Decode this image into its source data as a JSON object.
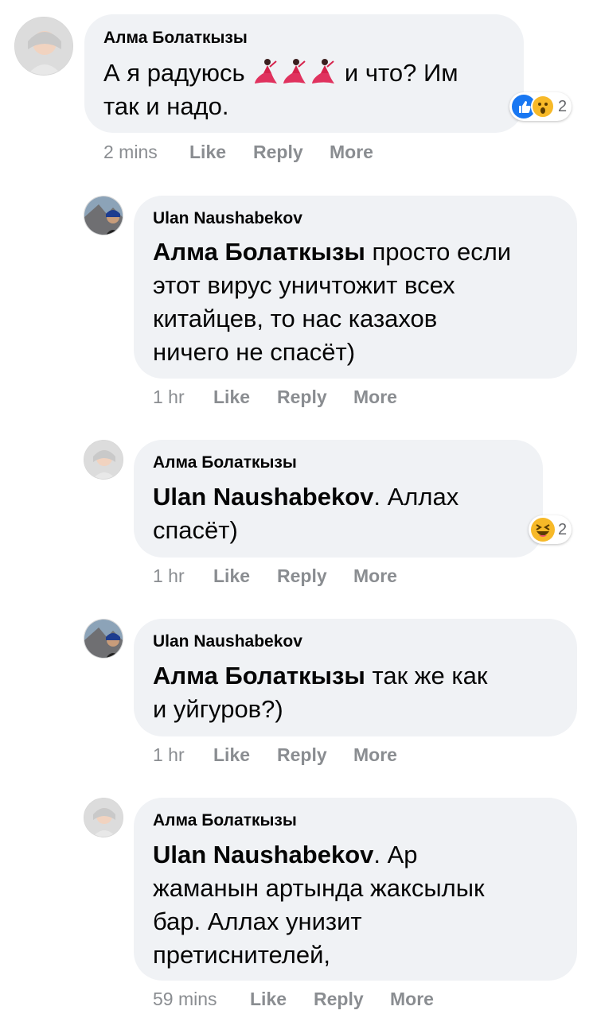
{
  "comments": [
    {
      "author": "Алма Болаткызы",
      "lines": [
        "А я радуюсь",
        "и что? Им",
        "так и надо."
      ],
      "reaction_count": "2",
      "time": "2 mins"
    },
    {
      "author": "Ulan Naushabekov",
      "mention": "Алма Болаткызы",
      "lines": [
        " просто если",
        "этот вирус уничтожит всех",
        "китайцев, то нас казахов",
        "ничего не спасёт)"
      ],
      "time": "1 hr"
    },
    {
      "author": "Алма Болаткызы",
      "mention": "Ulan Naushabekov",
      "lines": [
        ". Аллах",
        "спасёт)"
      ],
      "reaction_count": "2",
      "time": "1 hr"
    },
    {
      "author": "Ulan Naushabekov",
      "mention": "Алма Болаткызы",
      "lines": [
        " так же как",
        "и уйгуров?)"
      ],
      "time": "1 hr"
    },
    {
      "author": "Алма Болаткызы",
      "mention": "Ulan Naushabekov",
      "lines": [
        ". Ар",
        "жаманын артында жаксылык",
        "бар. Аллах унизит",
        "претиснителей,"
      ],
      "time": "59 mins"
    }
  ],
  "actions": {
    "like": "Like",
    "reply": "Reply",
    "more": "More"
  },
  "colors": {
    "bubble": "#f0f2f5",
    "meta": "#8a8d91",
    "like_blue": "#1877f2",
    "emoji_yellow": "#f7b928"
  },
  "icons": {
    "reaction_like": "like-icon",
    "reaction_wow": "wow-icon",
    "reaction_haha": "haha-icon",
    "inline_emoji": "dancer-emoji"
  }
}
